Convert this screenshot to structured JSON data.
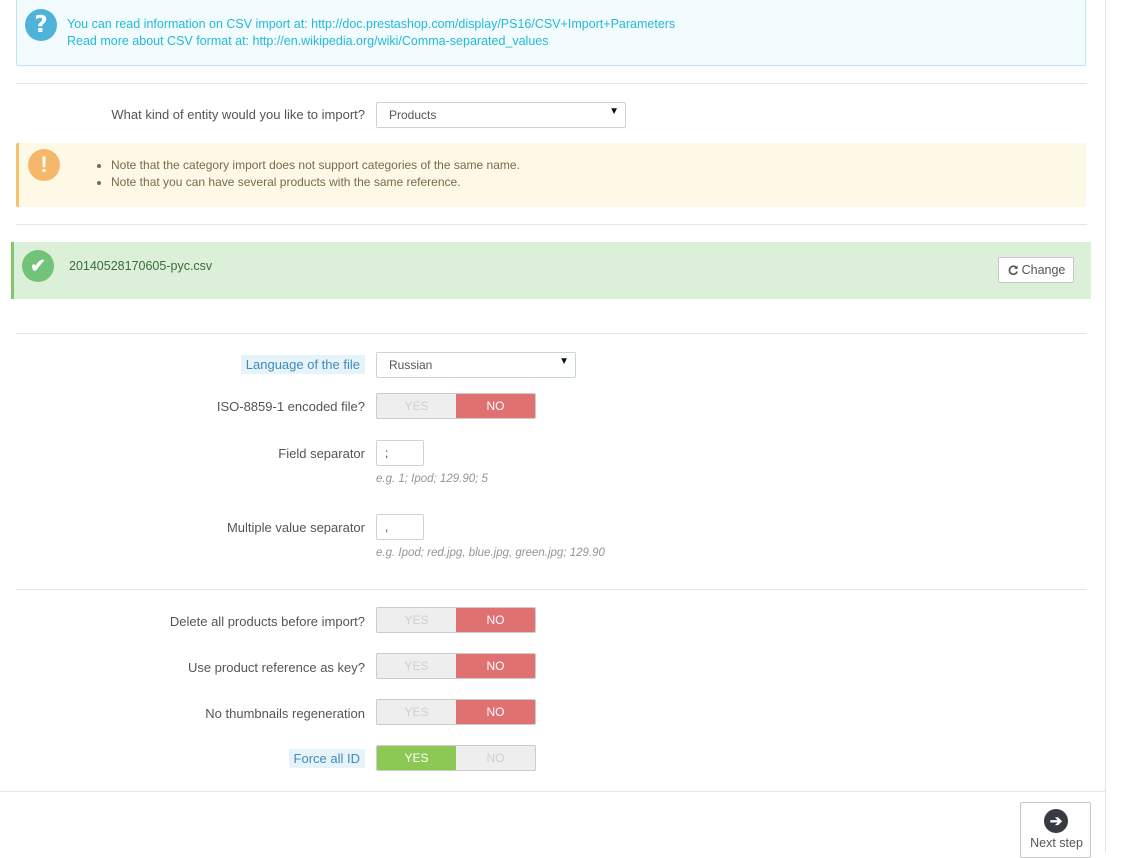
{
  "info_alert": {
    "line1": "You can read information on CSV import at: http://doc.prestashop.com/display/PS16/CSV+Import+Parameters",
    "line2": "Read more about CSV format at: http://en.wikipedia.org/wiki/Comma-separated_values",
    "icon": "question-icon"
  },
  "entity": {
    "label": "What kind of entity would you like to import?",
    "selected": "Products"
  },
  "warning_alert": {
    "icon": "exclamation-icon",
    "items": [
      "Note that the category import does not support categories of the same name.",
      "Note that you can have several products with the same reference."
    ]
  },
  "file": {
    "name": "20140528170605-pyc.csv",
    "change_label": "Change",
    "icon": "check-icon"
  },
  "language": {
    "label": "Language of the file",
    "selected": "Russian"
  },
  "iso": {
    "label": "ISO-8859-1 encoded file?",
    "yes": "YES",
    "no": "NO",
    "value": "NO"
  },
  "field_separator": {
    "label": "Field separator",
    "value": ";",
    "help": "e.g. 1; Ipod; 129.90; 5"
  },
  "multi_separator": {
    "label": "Multiple value separator",
    "value": ",",
    "help": "e.g. Ipod; red.jpg, blue.jpg, green.jpg; 129.90"
  },
  "delete_products": {
    "label": "Delete all products before import?",
    "yes": "YES",
    "no": "NO",
    "value": "NO"
  },
  "reference_key": {
    "label": "Use product reference as key?",
    "yes": "YES",
    "no": "NO",
    "value": "NO"
  },
  "no_thumbnails": {
    "label": "No thumbnails regeneration",
    "yes": "YES",
    "no": "NO",
    "value": "NO"
  },
  "force_id": {
    "label": "Force all ID",
    "yes": "YES",
    "no": "NO",
    "value": "YES"
  },
  "next_step": {
    "label": "Next step"
  },
  "colors": {
    "info": "#25b9d7",
    "warning": "#f5b86a",
    "success": "#72c279",
    "toggle_no": "#e07171",
    "toggle_yes": "#8bc954"
  }
}
